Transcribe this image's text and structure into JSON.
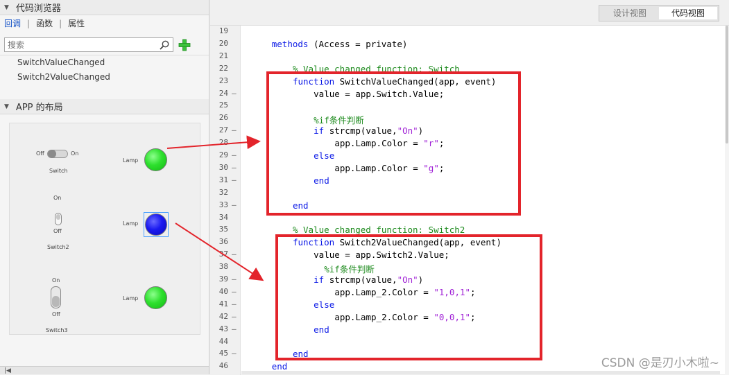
{
  "code_browser": {
    "title": "代码浏览器",
    "tabs": [
      "回调",
      "函数",
      "属性"
    ],
    "active_tab": 0,
    "search_placeholder": "搜索",
    "items": [
      "SwitchValueChanged",
      "Switch2ValueChanged"
    ]
  },
  "app_layout": {
    "title": "APP 的布局",
    "switch1": {
      "off_label": "Off",
      "on_label": "On",
      "name": "Switch"
    },
    "switch2": {
      "on_label": "On",
      "off_label": "Off",
      "name": "Switch2"
    },
    "switch3": {
      "on_label": "On",
      "off_label": "Off",
      "name": "Switch3"
    },
    "lamp_label": "Lamp",
    "lamp_colors": [
      "#22dd22",
      "#1414ee",
      "#22dd22"
    ]
  },
  "view_toggle": {
    "design": "设计视图",
    "code": "代码视图",
    "active": "code"
  },
  "code": {
    "line_numbers": [
      "19",
      "20",
      "21",
      "22",
      "23",
      "24",
      "25",
      "26",
      "27",
      "28",
      "29",
      "30",
      "31",
      "32",
      "33",
      "34",
      "35",
      "36",
      "37",
      "38",
      "39",
      "40",
      "41",
      "42",
      "43",
      "44",
      "45",
      "46"
    ],
    "dash_lines": [
      "24",
      "27",
      "28",
      "29",
      "30",
      "31",
      "33",
      "37",
      "39",
      "40",
      "41",
      "42",
      "43",
      "45"
    ],
    "lines": [
      "",
      "methods (Access = private)",
      "",
      "% Value changed function: Switch",
      "function SwitchValueChanged(app, event)",
      "value = app.Switch.Value;",
      "",
      "%if条件判断",
      "if strcmp(value,\"On\")",
      "app.Lamp.Color = \"r\";",
      "else",
      "app.Lamp.Color = \"g\";",
      "end",
      "",
      "end",
      "",
      "% Value changed function: Switch2",
      "function Switch2ValueChanged(app, event)",
      "value = app.Switch2.Value;",
      "%if条件判断",
      "if strcmp(value,\"On\")",
      "app.Lamp_2.Color = \"1,0,1\";",
      "else",
      "app.Lamp_2.Color = \"0,0,1\";",
      "end",
      "",
      "end",
      "end"
    ]
  },
  "watermark": "CSDN @是刃小木啦~",
  "accent_colors": {
    "keyword": "#0a18e6",
    "comment": "#1c8a1c",
    "string": "#a022d6",
    "highlight": "#e3242b"
  }
}
